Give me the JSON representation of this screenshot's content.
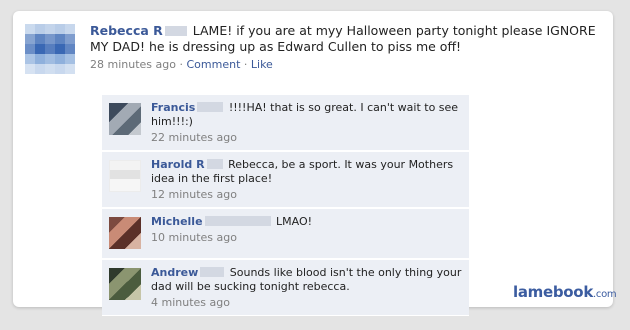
{
  "post": {
    "author": "Rebecca R",
    "text": "LAME! if you are at myy Halloween party tonight please IGNORE MY DAD! he is dressing up as Edward Cullen to piss me off!",
    "time": "28 minutes ago",
    "sep": "·",
    "comment_label": "Comment",
    "like_label": "Like"
  },
  "comments": [
    {
      "author": "Francis",
      "text": "!!!!HA! that is so great. I can't wait to see him!!!:)",
      "time": "22 minutes ago"
    },
    {
      "author": "Harold R",
      "text": "Rebecca, be a sport. It was your Mothers idea in the first place!",
      "time": "12 minutes ago"
    },
    {
      "author": "Michelle",
      "text": "LMAO!",
      "time": "10 minutes ago"
    },
    {
      "author": "Andrew",
      "text": "Sounds like blood isn't the only thing your dad will be sucking tonight rebecca.",
      "time": "4 minutes ago"
    }
  ],
  "watermark": {
    "brand": "lamebook",
    "tld": ".com"
  },
  "colors": {
    "link": "#3b5998",
    "comment_bg": "#eceff5",
    "background": "#e4e4e4"
  }
}
